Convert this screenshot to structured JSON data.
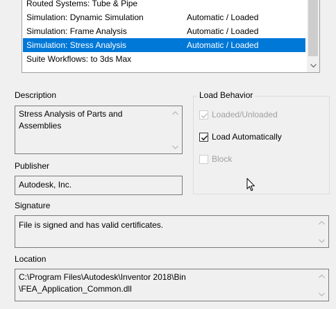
{
  "addins": {
    "rows": [
      {
        "name": "Routed Systems: Tube & Pipe",
        "behavior": ""
      },
      {
        "name": "Simulation: Dynamic Simulation",
        "behavior": "Automatic / Loaded"
      },
      {
        "name": "Simulation: Frame Analysis",
        "behavior": "Automatic / Loaded"
      },
      {
        "name": "Simulation: Stress Analysis",
        "behavior": "Automatic / Loaded"
      },
      {
        "name": "Suite Workflows: to 3ds Max",
        "behavior": ""
      }
    ],
    "selected_index": 3
  },
  "description": {
    "label": "Description",
    "value": "Stress Analysis of Parts and\nAssemblies"
  },
  "publisher": {
    "label": "Publisher",
    "value": "Autodesk, Inc."
  },
  "signature": {
    "label": "Signature",
    "value": "File is signed and has valid certificates."
  },
  "location": {
    "label": "Location",
    "value": "C:\\Program Files\\Autodesk\\Inventor 2018\\Bin\n\\FEA_Application_Common.dll"
  },
  "load_behavior": {
    "title": "Load Behavior",
    "loaded_unloaded": {
      "label": "Loaded/Unloaded",
      "checked": true,
      "enabled": false
    },
    "load_automatically": {
      "label": "Load Automatically",
      "checked": true,
      "enabled": true
    },
    "block": {
      "label": "Block",
      "checked": false,
      "enabled": false
    }
  },
  "colors": {
    "selection": "#0078d7",
    "window_bg": "#f0f0f0"
  }
}
